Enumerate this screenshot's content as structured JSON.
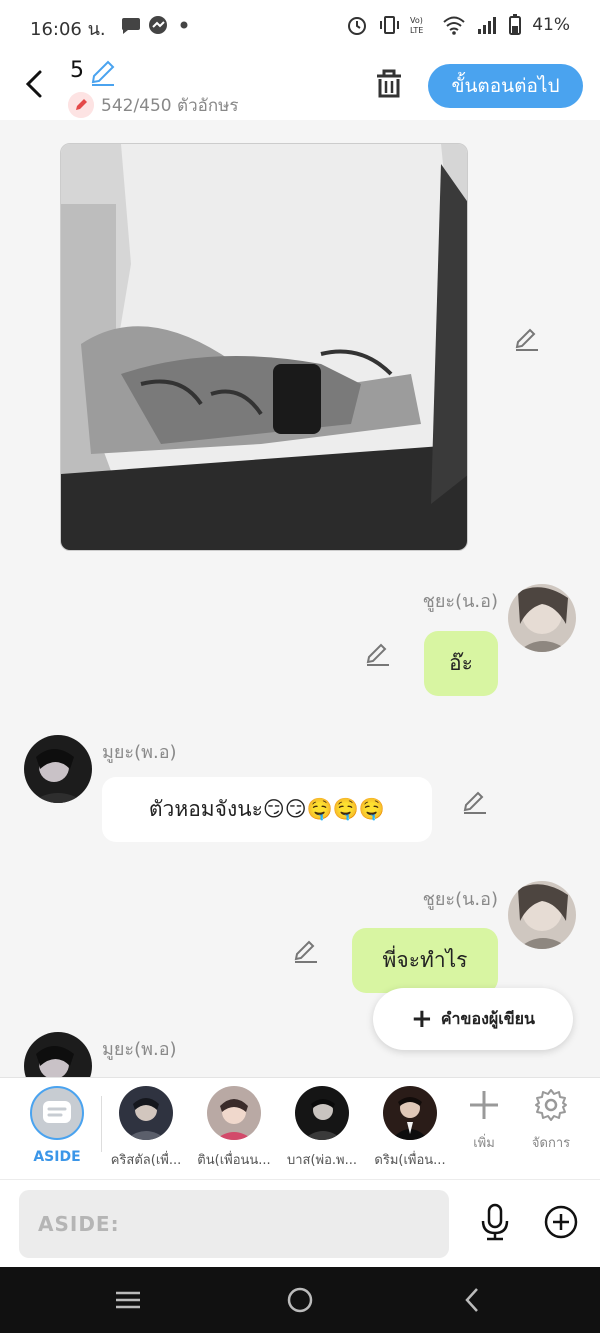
{
  "status_bar": {
    "time": "16:06 น.",
    "battery": "41%"
  },
  "header": {
    "episode": "5",
    "char_count": "542/450 ตัวอักษร",
    "next_label": "ขั้นตอนต่อไป"
  },
  "messages": [
    {
      "type": "image",
      "side": "left"
    },
    {
      "type": "text",
      "side": "right",
      "name": "ชูยะ(น.อ)",
      "text": "อ๊ะ"
    },
    {
      "type": "text",
      "side": "left",
      "name": "มูยะ(พ.อ)",
      "text": "ตัวหอมจังนะ😏😏🤤🤤🤤"
    },
    {
      "type": "text",
      "side": "right",
      "name": "ชูยะ(น.อ)",
      "text": "พี่จะทำไร"
    },
    {
      "type": "text",
      "side": "left",
      "name": "มูยะ(พ.อ)",
      "text": ""
    }
  ],
  "author_button": "คำของผู้เขียน",
  "characters": [
    {
      "label": "ASIDE"
    },
    {
      "label": "คริสตัล(เพื่..."
    },
    {
      "label": "ติน(เพื่อนน..."
    },
    {
      "label": "บาส(พ่อ.พ..."
    },
    {
      "label": "ดริม(เพื่อน..."
    }
  ],
  "tools": {
    "add_label": "เพิ่ม",
    "manage_label": "จัดการ"
  },
  "composer": {
    "placeholder": "ASIDE:"
  },
  "colors": {
    "accent": "#4aa3ef",
    "bubble_green": "#d8f5a2",
    "background": "#f5f5f5"
  }
}
